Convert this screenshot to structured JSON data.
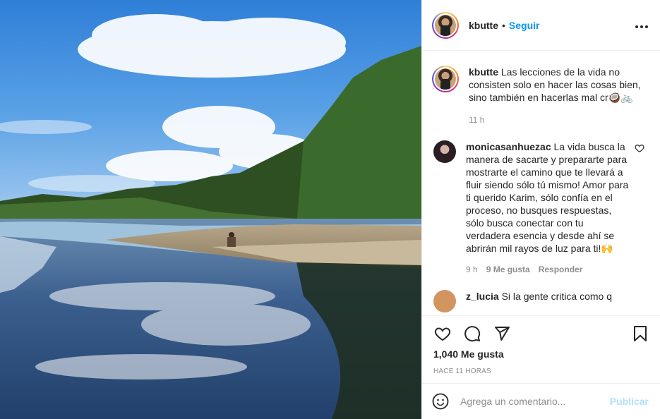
{
  "post": {
    "author": {
      "username": "kbutte",
      "separator": "•",
      "follow_label": "Seguir",
      "more_icon": "more-horizontal-icon"
    },
    "caption": {
      "username": "kbutte",
      "text": "Las lecciones de la vida no consisten solo en hacer las cosas bien, sino también en hacerlas mal cr🥥🚲",
      "time": "11 h"
    },
    "comments": [
      {
        "username": "monicasanhuezac",
        "text": "La vida busca la manera de sacarte y prepararte para mostrarte el camino que te llevará a fluir siendo sólo tú mismo! Amor para ti querido Karim, sólo confía en el proceso, no busques respuestas, sólo busca conectar con tu verdadera esencia y desde ahí se abrirán mil rayos de luz para ti!🙌",
        "time": "9 h",
        "likes": "9 Me gusta",
        "reply_label": "Responder"
      },
      {
        "username": "z_lucia",
        "text": "Si la gente critica como q"
      }
    ],
    "likes_count": "1,040 Me gusta",
    "posted_ago": "HACE 11 HORAS",
    "comment_input": {
      "placeholder": "Agrega un comentario...",
      "value": ""
    },
    "publish_label": "Publicar",
    "icons": [
      "heart-icon",
      "comment-icon",
      "share-icon",
      "bookmark-icon",
      "emoji-icon"
    ],
    "colors": {
      "accent": "#0095f6",
      "publish_disabled": "#b2dffc",
      "muted": "#8e8e8e",
      "text": "#262626"
    }
  }
}
